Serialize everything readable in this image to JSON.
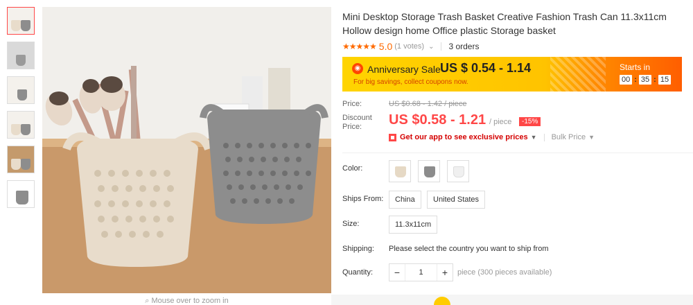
{
  "product": {
    "title": "Mini Desktop Storage Trash Basket Creative Fashion Trash Can 11.3x11cm Hollow design home Office plastic Storage basket",
    "stars": "★★★★★",
    "score": "5.0",
    "votes": "(1 votes)",
    "orders": "3 orders"
  },
  "sale": {
    "name": "Anniversary Sale",
    "price": "US $ 0.54 - 1.14",
    "subtext": "For big savings, collect coupons now.",
    "starts_label": "Starts in",
    "timer": [
      "00",
      "35",
      "15"
    ]
  },
  "pricing": {
    "price_label": "Price:",
    "original_price": "US $0.68 - 1.42 / piece",
    "discount_label": "Discount Price:",
    "discount_price": "US $0.58 - 1.21",
    "per_unit": "/ piece",
    "discount_badge": "-15%",
    "app_promo": "Get our app to see exclusive prices",
    "bulk_price": "Bulk Price"
  },
  "options": {
    "color_label": "Color:",
    "colors": [
      {
        "name": "beige",
        "hex": "#e6d9c5"
      },
      {
        "name": "grey",
        "hex": "#8c8c8c"
      },
      {
        "name": "white",
        "hex": "#f0f0f0"
      }
    ],
    "ships_from_label": "Ships From:",
    "ships_from": [
      "China",
      "United States"
    ],
    "size_label": "Size:",
    "sizes": [
      "11.3x11cm"
    ],
    "shipping_label": "Shipping:",
    "shipping_text": "Please select the country you want to ship from",
    "quantity_label": "Quantity:",
    "quantity_value": "1",
    "quantity_minus": "−",
    "quantity_plus": "+",
    "availability": "piece (300 pieces available)"
  },
  "gallery": {
    "zoom_hint": "Mouse over to zoom in",
    "zoom_icon": "magnifier-icon"
  },
  "colors": {
    "accent": "#ff4747",
    "sale_yellow": "#ffd400",
    "sale_orange": "#ff5e00"
  }
}
